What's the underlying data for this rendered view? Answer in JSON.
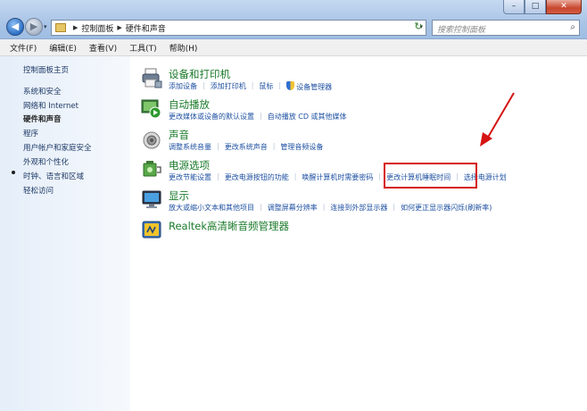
{
  "window": {
    "controls": {
      "minimize": "–",
      "maximize": "□",
      "close": "✕"
    }
  },
  "nav": {
    "back_icon": "back-arrow-icon",
    "forward_icon": "forward-arrow-icon",
    "back_glyph": "◀",
    "forward_glyph": "▶",
    "dropdown_glyph": "▾"
  },
  "address": {
    "crumbs": [
      "控制面板",
      "硬件和声音"
    ],
    "separator": "▶",
    "dropdown_glyph": "▾",
    "refresh_glyph": "↻"
  },
  "search": {
    "placeholder": "搜索控制面板",
    "icon_glyph": "⌕"
  },
  "menu": {
    "items": [
      "文件(F)",
      "编辑(E)",
      "查看(V)",
      "工具(T)",
      "帮助(H)"
    ]
  },
  "sidebar": {
    "items": [
      {
        "label": "控制面板主页"
      },
      {
        "label": "系统和安全"
      },
      {
        "label": "网络和 Internet"
      },
      {
        "label": "硬件和声音",
        "active": true
      },
      {
        "label": "程序"
      },
      {
        "label": "用户帐户和家庭安全"
      },
      {
        "label": "外观和个性化"
      },
      {
        "label": "时钟、语言和区域"
      },
      {
        "label": "轻松访问"
      }
    ]
  },
  "categories": [
    {
      "title": "设备和打印机",
      "icon": "printer-icon",
      "links": [
        "添加设备",
        "添加打印机",
        "鼠标",
        "设备管理器"
      ]
    },
    {
      "title": "自动播放",
      "icon": "autoplay-icon",
      "links": [
        "更改媒体或设备的默认设置",
        "自动播放 CD 或其他媒体"
      ]
    },
    {
      "title": "声音",
      "icon": "speaker-icon",
      "links": [
        "调整系统音量",
        "更改系统声音",
        "管理音频设备"
      ]
    },
    {
      "title": "电源选项",
      "icon": "battery-icon",
      "links": [
        "更改节能设置",
        "更改电源按钮的功能",
        "唤醒计算机时需要密码",
        "更改计算机睡眠时间",
        "选择电源计划"
      ]
    },
    {
      "title": "显示",
      "icon": "monitor-icon",
      "links": [
        "放大或缩小文本和其他项目",
        "调整屏幕分辨率",
        "连接到外部显示器",
        "如何更正显示器闪烁(刷新率)"
      ]
    },
    {
      "title": "Realtek高清晰音频管理器",
      "icon": "realtek-audio-icon",
      "links": []
    }
  ],
  "colors": {
    "category_title": "#1a7a2a",
    "link": "#1e50a2",
    "highlight": "#d51414"
  }
}
